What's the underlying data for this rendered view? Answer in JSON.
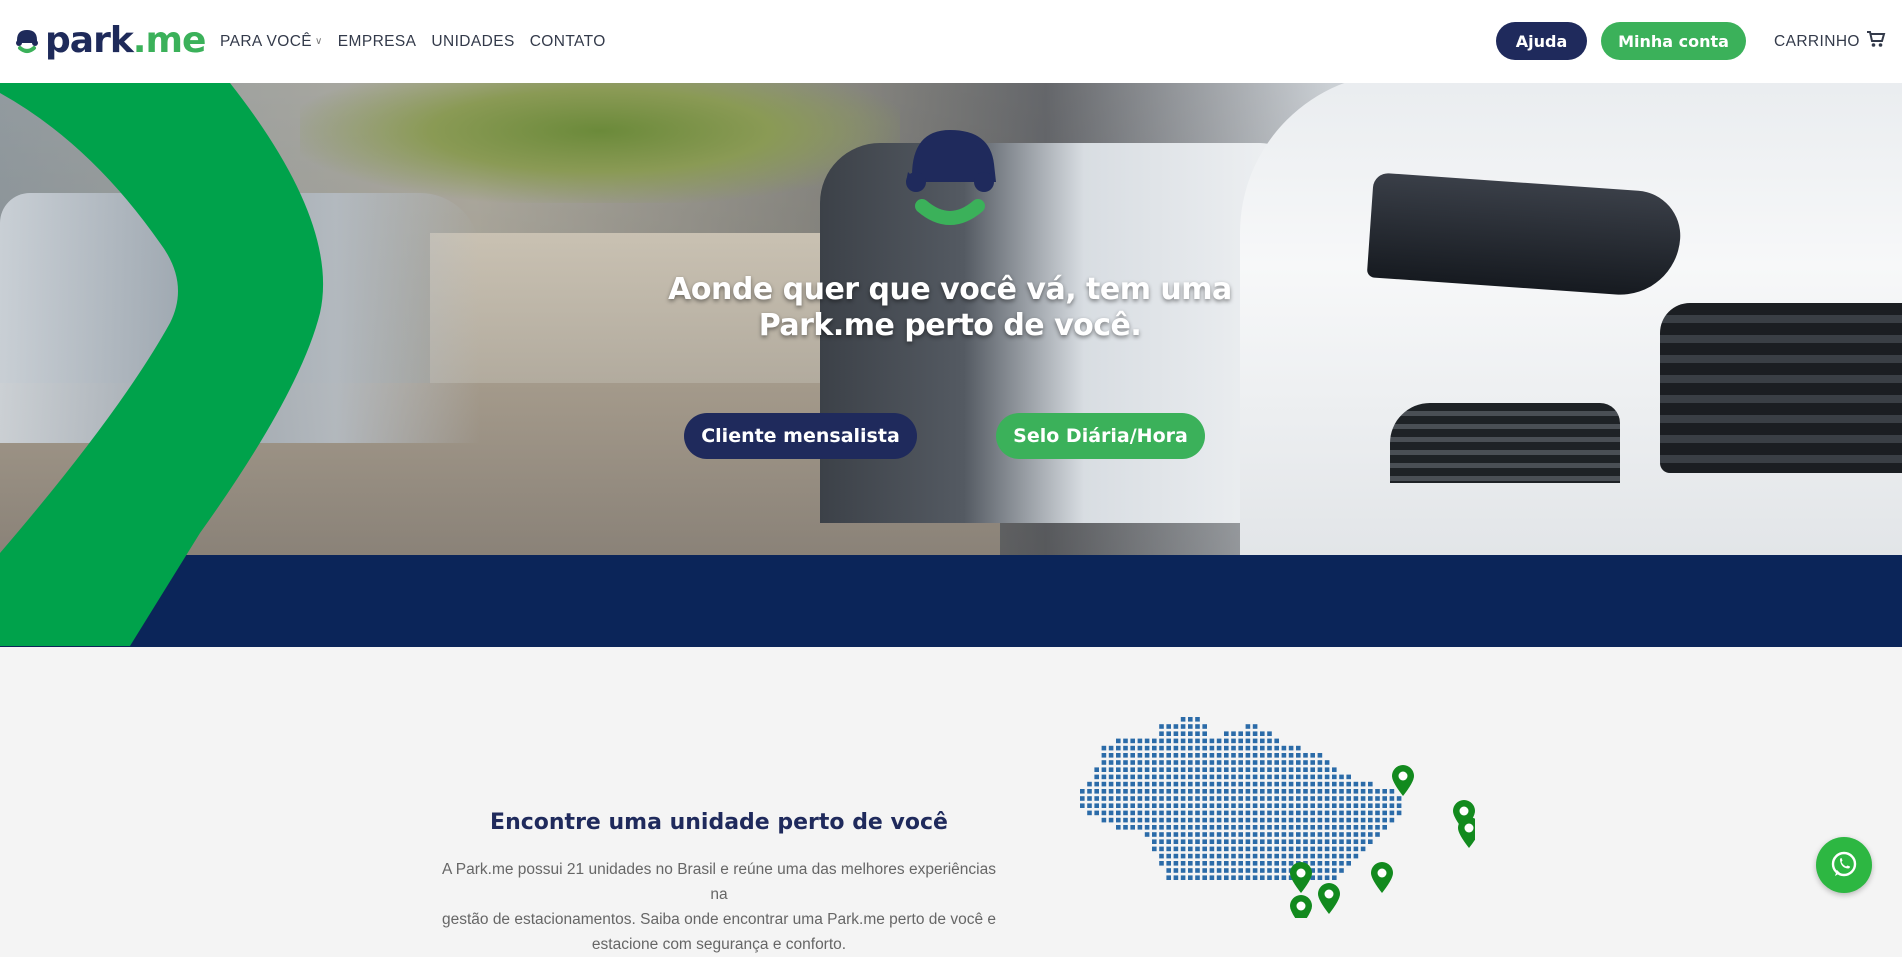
{
  "header": {
    "logo": {
      "park": "park",
      "me": ".me"
    },
    "nav": [
      {
        "label": "PARA VOCÊ",
        "has_dropdown": true
      },
      {
        "label": "EMPRESA"
      },
      {
        "label": "UNIDADES"
      },
      {
        "label": "CONTATO"
      }
    ],
    "help_label": "Ajuda",
    "account_label": "Minha conta",
    "cart_label": "CARRINHO",
    "cart_icon": "cart-icon"
  },
  "hero": {
    "title_line1": "Aonde quer que você vá, tem uma",
    "title_line2": "Park.me perto de você.",
    "monthly_label": "Cliente mensalista",
    "daily_label": "Selo Diária/Hora"
  },
  "units": {
    "title": "Encontre uma unidade perto de você",
    "desc_line1": "A Park.me possui 21 unidades no Brasil e reúne uma das melhores experiências na",
    "desc_line2": "gestão de estacionamentos. Saiba onde encontrar uma Park.me perto de você e",
    "desc_line3": "estacione com segurança e conforto."
  },
  "colors": {
    "navy": "#1f2a5c",
    "green": "#3bb15a",
    "band": "#0b2559",
    "whatsapp": "#2db742"
  },
  "icons": [
    "cart-icon",
    "chevron-down-icon",
    "whatsapp-icon",
    "map-pin-icon",
    "parkme-car-logo-icon"
  ]
}
